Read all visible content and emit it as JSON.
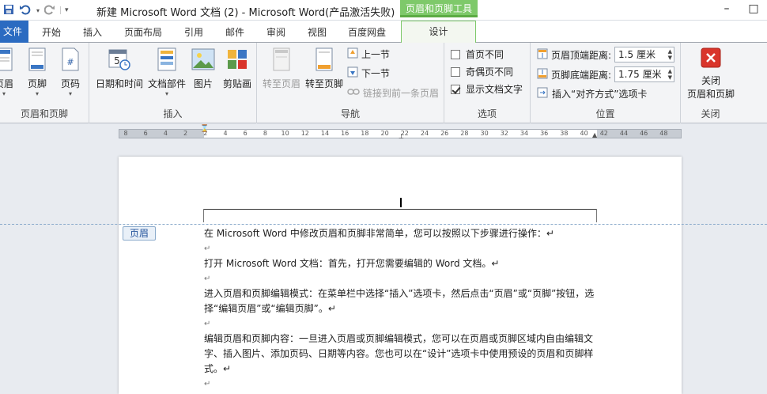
{
  "window": {
    "title": "新建 Microsoft Word 文档 (2)  -  Microsoft Word(产品激活失败)",
    "context_tool_title": "页眉和页脚工具",
    "minimize": "–",
    "maximize": "□"
  },
  "tabs": {
    "file": "文件",
    "home": "开始",
    "insert": "插入",
    "layout": "页面布局",
    "references": "引用",
    "mailings": "邮件",
    "review": "审阅",
    "view": "视图",
    "baidu": "百度网盘",
    "design": "设计"
  },
  "ribbon": {
    "hf_group": {
      "header": "页眉",
      "footer": "页脚",
      "page_number": "页码",
      "label": "页眉和页脚"
    },
    "insert_group": {
      "datetime": "日期和时间",
      "docparts": "文档部件",
      "picture": "图片",
      "clipart": "剪贴画",
      "label": "插入"
    },
    "nav_group": {
      "goto_header": "转至页眉",
      "goto_footer": "转至页脚",
      "prev": "上一节",
      "next": "下一节",
      "link_prev": "链接到前一条页眉",
      "label": "导航"
    },
    "options_group": {
      "diff_first": "首页不同",
      "diff_odd_even": "奇偶页不同",
      "show_doc_text": "显示文档文字",
      "label": "选项"
    },
    "position_group": {
      "header_top_label": "页眉顶端距离:",
      "header_top_value": "1.5 厘米",
      "footer_bottom_label": "页脚底端距离:",
      "footer_bottom_value": "1.75 厘米",
      "insert_align_tab": "插入“对齐方式”选项卡",
      "label": "位置"
    },
    "close_group": {
      "close_line1": "关闭",
      "close_line2": "页眉和页脚",
      "label": "关闭"
    }
  },
  "ruler": {
    "labels": [
      "8",
      "6",
      "4",
      "2",
      "2",
      "4",
      "6",
      "8",
      "10",
      "12",
      "14",
      "16",
      "18",
      "20",
      "22",
      "24",
      "26",
      "28",
      "30",
      "32",
      "34",
      "36",
      "38",
      "40",
      "42",
      "44",
      "46",
      "48"
    ]
  },
  "document": {
    "header_tag": "页眉",
    "paragraphs": [
      "在 Microsoft Word 中修改页眉和页脚非常简单，您可以按照以下步骤进行操作：↵",
      "↵",
      "打开 Microsoft Word 文档：首先，打开您需要编辑的 Word 文档。↵",
      "↵",
      "进入页眉和页脚编辑模式：在菜单栏中选择“插入”选项卡，然后点击“页眉”或“页脚”按钮，选择“编辑页眉”或“编辑页脚”。↵",
      "↵",
      "编辑页眉和页脚内容：一旦进入页眉或页脚编辑模式，您可以在页眉或页脚区域内自由编辑文字、插入图片、添加页码、日期等内容。您也可以在“设计”选项卡中使用预设的页眉和页脚样式。↵",
      "↵"
    ]
  },
  "colors": {
    "file_tab": "#2b6bc1",
    "context_green": "#7ec96a",
    "close_red": "#d9352b"
  }
}
